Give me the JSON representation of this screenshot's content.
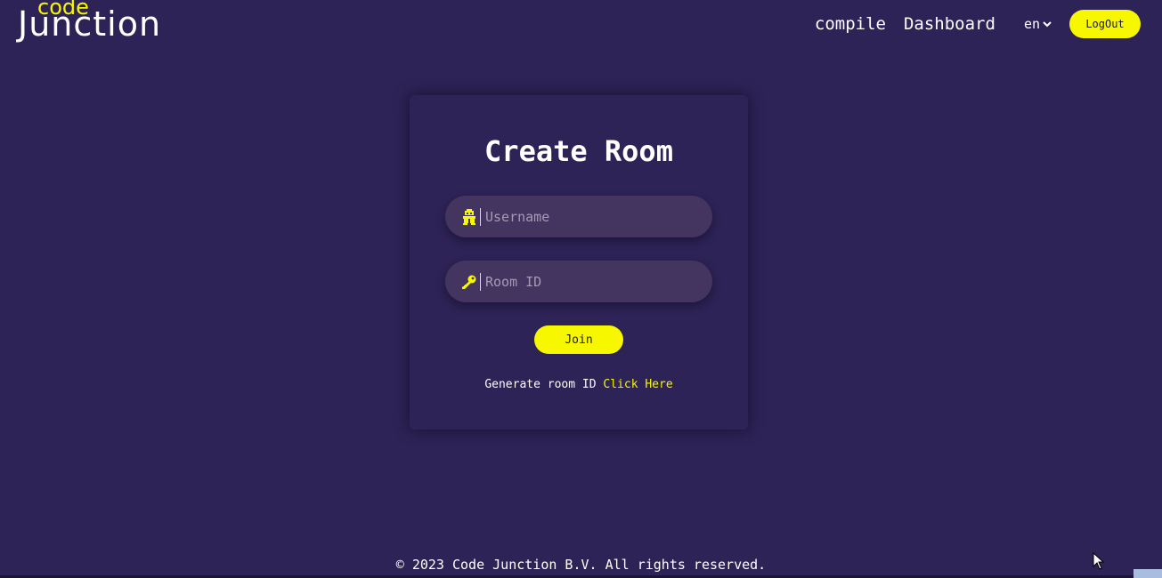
{
  "header": {
    "logo_top": "code",
    "logo_main": "Junction",
    "nav": {
      "compile_label": "compile",
      "dashboard_label": "Dashboard",
      "language": "en",
      "logout_label": "LogOut"
    }
  },
  "form": {
    "title": "Create Room",
    "username": {
      "placeholder": "Username",
      "value": "",
      "icon": "user-icon"
    },
    "room_id": {
      "placeholder": "Room ID",
      "value": "",
      "icon": "key-icon"
    },
    "join_label": "Join",
    "generate_text": "Generate room ID",
    "generate_link": "Click Here"
  },
  "footer": {
    "copyright": "© 2023 Code Junction B.V. All rights reserved."
  },
  "colors": {
    "background": "#2d2356",
    "accent": "#f7f700",
    "input_bg": "#43355f"
  }
}
